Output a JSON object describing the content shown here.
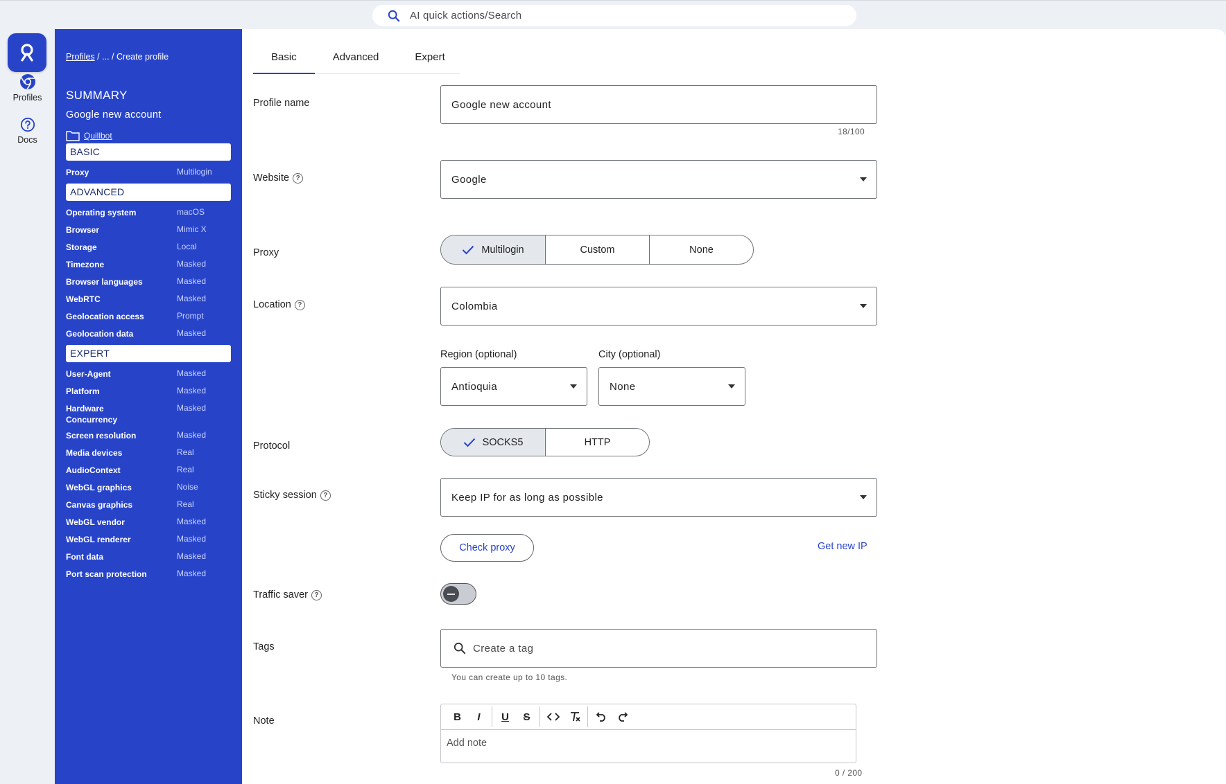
{
  "search": {
    "placeholder": "AI quick actions/Search"
  },
  "rail": {
    "items": [
      {
        "label": "Profiles",
        "icon": "chrome-icon"
      },
      {
        "label": "Docs",
        "icon": "help-circle-icon"
      }
    ]
  },
  "breadcrumb": {
    "root": "Profiles",
    "sep1": "/",
    "ellipsis": "...",
    "sep2": "/",
    "current": "Create profile"
  },
  "summary": {
    "title": "SUMMARY",
    "profile_name": "Google new account",
    "folder": "Quillbot",
    "sections": [
      {
        "title": "BASIC",
        "rows": [
          {
            "k": "Proxy",
            "v": "Multilogin"
          }
        ]
      },
      {
        "title": "ADVANCED",
        "rows": [
          {
            "k": "Operating system",
            "v": "macOS"
          },
          {
            "k": "Browser",
            "v": "Mimic X"
          },
          {
            "k": "Storage",
            "v": "Local"
          },
          {
            "k": "Timezone",
            "v": "Masked"
          },
          {
            "k": "Browser languages",
            "v": "Masked"
          },
          {
            "k": "WebRTC",
            "v": "Masked"
          },
          {
            "k": "Geolocation access",
            "v": "Prompt"
          },
          {
            "k": "Geolocation data",
            "v": "Masked"
          }
        ]
      },
      {
        "title": "EXPERT",
        "rows": [
          {
            "k": "User-Agent",
            "v": "Masked"
          },
          {
            "k": "Platform",
            "v": "Masked"
          },
          {
            "k": "Hardware Concurrency",
            "v": "Masked"
          },
          {
            "k": "Screen resolution",
            "v": "Masked"
          },
          {
            "k": "Media devices",
            "v": "Real"
          },
          {
            "k": "AudioContext",
            "v": "Real"
          },
          {
            "k": "WebGL graphics",
            "v": "Noise"
          },
          {
            "k": "Canvas graphics",
            "v": "Real"
          },
          {
            "k": "WebGL vendor",
            "v": "Masked"
          },
          {
            "k": "WebGL renderer",
            "v": "Masked"
          },
          {
            "k": "Font data",
            "v": "Masked"
          },
          {
            "k": "Port scan protection",
            "v": "Masked"
          }
        ]
      }
    ]
  },
  "tabs": [
    {
      "label": "Basic",
      "active": true
    },
    {
      "label": "Advanced"
    },
    {
      "label": "Expert"
    }
  ],
  "form": {
    "profile_name": {
      "label": "Profile name",
      "value": "Google new account",
      "counter": "18/100"
    },
    "website": {
      "label": "Website",
      "value": "Google"
    },
    "proxy": {
      "label": "Proxy",
      "options": [
        "Multilogin",
        "Custom",
        "None"
      ],
      "selected": "Multilogin"
    },
    "location": {
      "label": "Location",
      "value": "Colombia"
    },
    "region": {
      "label": "Region (optional)",
      "value": "Antioquia"
    },
    "city": {
      "label": "City (optional)",
      "value": "None"
    },
    "protocol": {
      "label": "Protocol",
      "options": [
        "SOCKS5",
        "HTTP"
      ],
      "selected": "SOCKS5"
    },
    "sticky_session": {
      "label": "Sticky session",
      "value": "Keep IP for as long as possible"
    },
    "check_proxy": "Check proxy",
    "get_new_ip": "Get new IP",
    "traffic_saver": {
      "label": "Traffic saver",
      "enabled": false
    },
    "tags": {
      "label": "Tags",
      "placeholder": "Create a tag",
      "hint": "You can create up to 10 tags."
    },
    "note": {
      "label": "Note",
      "placeholder": "Add note",
      "counter": "0 / 200"
    }
  },
  "colors": {
    "accent": "#2744c9",
    "background": "#edf0f5"
  }
}
